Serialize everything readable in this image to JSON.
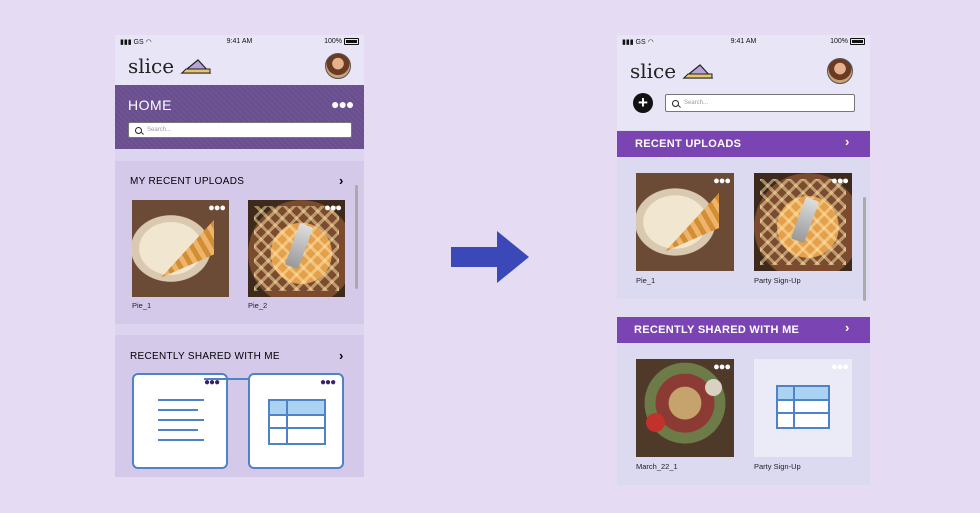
{
  "status": {
    "carrier": "GS",
    "time": "9:41 AM",
    "battery": "100%"
  },
  "app": {
    "logo": "slice"
  },
  "left": {
    "title": "HOME",
    "search_placeholder": "Search...",
    "section1": {
      "title": "MY RECENT UPLOADS",
      "items": [
        {
          "caption": "Pie_1"
        },
        {
          "caption": "Pie_2"
        }
      ]
    },
    "section2": {
      "title": "RECENTLY SHARED WITH ME"
    }
  },
  "right": {
    "search_placeholder": "Search...",
    "section1": {
      "title": "RECENT UPLOADS",
      "items": [
        {
          "caption": "Pie_1"
        },
        {
          "caption": "Party Sign-Up"
        }
      ]
    },
    "section2": {
      "title": "RECENTLY SHARED WITH ME",
      "items": [
        {
          "caption": "March_22_1"
        },
        {
          "caption": "Party Sign-Up"
        }
      ]
    }
  },
  "colors": {
    "background": "#e5dcf3",
    "accent_purple": "#7a44b3",
    "doc_blue": "#4f82c7"
  },
  "icons": [
    "signal-icon",
    "wifi-icon",
    "battery-icon",
    "pie-logo-icon",
    "more-icon",
    "search-icon",
    "chevron-right-icon",
    "plus-icon",
    "document-icon",
    "spreadsheet-icon",
    "arrow-right-icon"
  ]
}
